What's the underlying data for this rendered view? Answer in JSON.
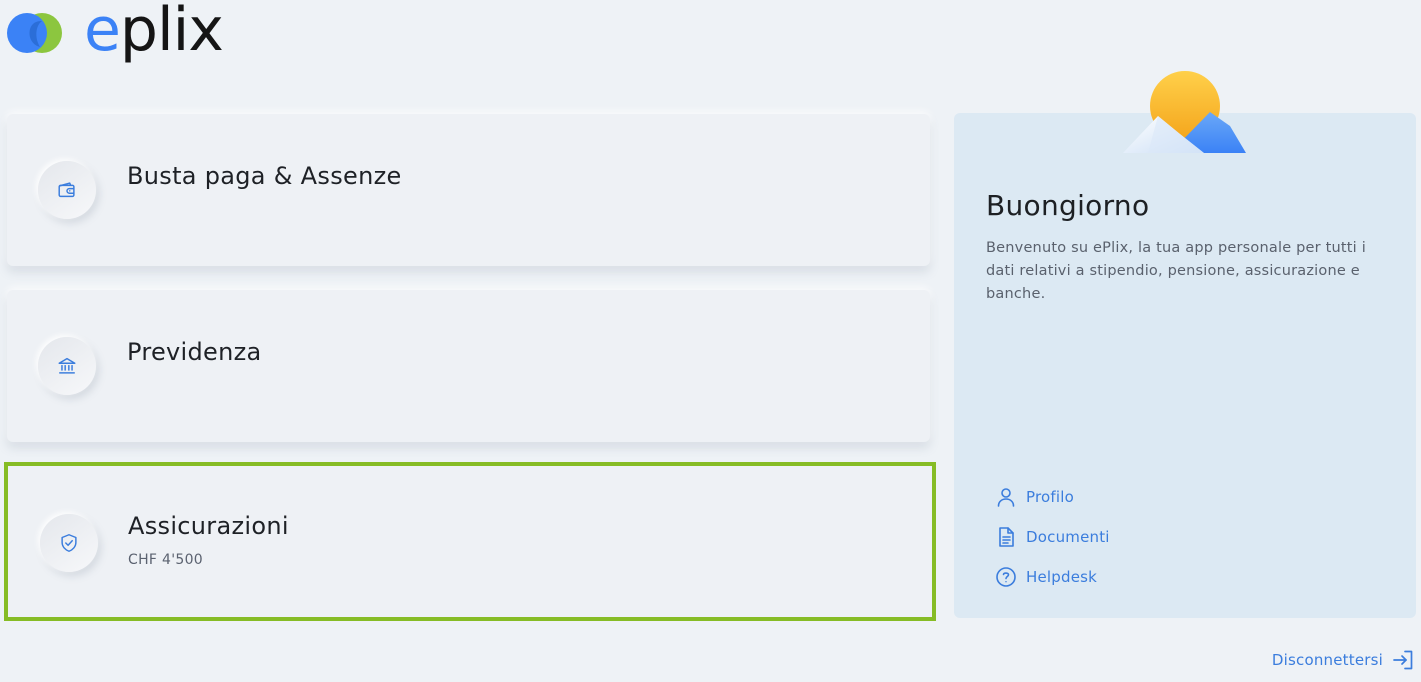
{
  "brand": {
    "name_prefix": "e",
    "name_rest": "plix"
  },
  "cards": [
    {
      "title": "Busta paga & Assenze",
      "subtitle": "",
      "icon": "wallet-icon"
    },
    {
      "title": "Previdenza",
      "subtitle": "",
      "icon": "bank-icon"
    },
    {
      "title": "Assicurazioni",
      "subtitle": "CHF 4'500",
      "icon": "shield-check-icon",
      "selected": true
    }
  ],
  "panel": {
    "greeting": "Buongiorno",
    "welcome_text": "Benvenuto su ePlix, la tua app personale per tutti i dati relativi a stipendio, pensione, assicurazione e banche.",
    "links": [
      {
        "label": "Profilo",
        "icon": "user-icon"
      },
      {
        "label": "Documenti",
        "icon": "document-icon"
      },
      {
        "label": "Helpdesk",
        "icon": "help-icon"
      }
    ]
  },
  "logout": {
    "label": "Disconnettersi",
    "icon": "logout-icon"
  },
  "colors": {
    "background": "#eef2f6",
    "accent": "#3b7ddd",
    "brand_blue": "#3b82f6",
    "brand_green": "#8cc63f",
    "selected_border": "#86bc25",
    "panel_bg": "#dce9f3"
  }
}
